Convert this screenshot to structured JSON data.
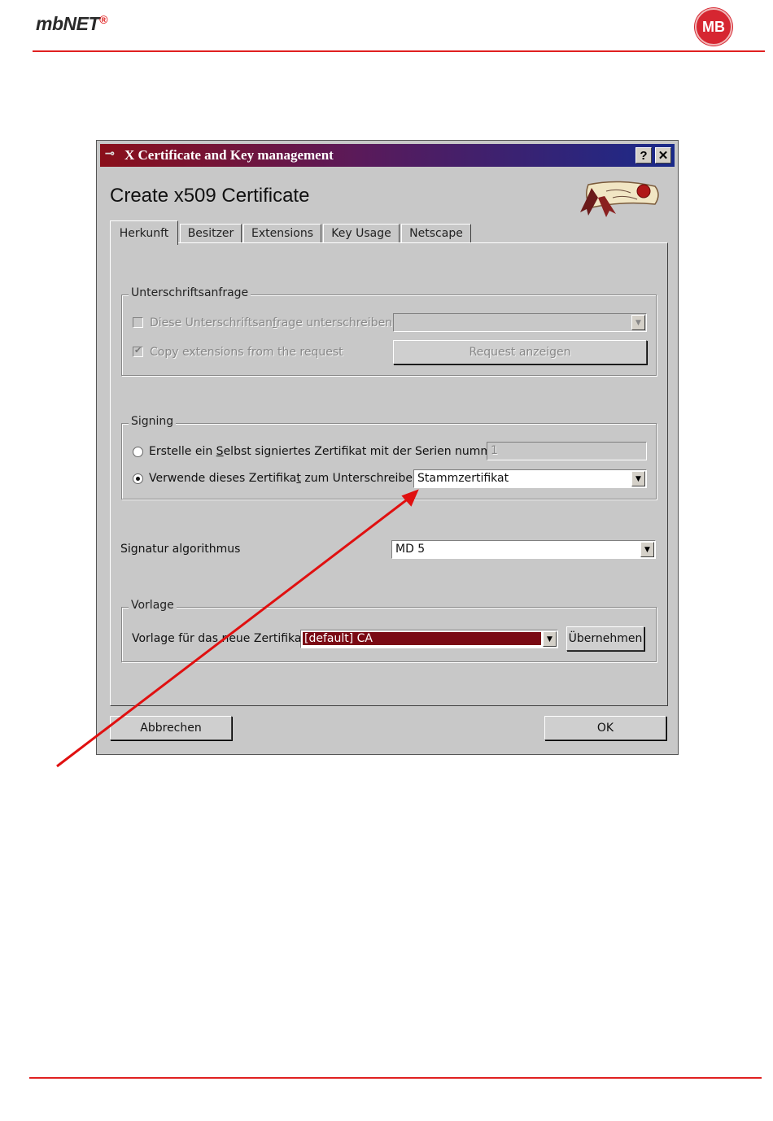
{
  "page": {
    "logo_text": "mbNET",
    "logo_mark": "®",
    "badge_text": "MB",
    "accent_color": "#e02020"
  },
  "dialog": {
    "title": "X Certificate and Key management",
    "help_button": "?",
    "close_button": "✕",
    "heading": "Create x509 Certificate",
    "tabs": [
      {
        "label": "Herkunft",
        "active": true
      },
      {
        "label": "Besitzer",
        "active": false
      },
      {
        "label": "Extensions",
        "active": false
      },
      {
        "label": "Key Usage",
        "active": false
      },
      {
        "label": "Netscape",
        "active": false
      }
    ],
    "request_group": {
      "label": "Unterschriftsanfrage",
      "sign_request": {
        "prefix": "Diese Unterschriftsan",
        "hotkey": "f",
        "suffix": "rage unterschreiben",
        "checked": false,
        "enabled": false
      },
      "request_select_value": "",
      "copy_extensions": {
        "label": "Copy extensions from the request",
        "checked": true,
        "enabled": false
      },
      "show_request_button": "Request anzeigen"
    },
    "signing_group": {
      "label": "Signing",
      "self_signed": {
        "prefix": "Erstelle ein ",
        "hotkey": "S",
        "suffix": "elbst signiertes Zertifikat mit der Serien nummer",
        "selected": false
      },
      "serial_value": "1",
      "use_cert": {
        "prefix": "Verwende dieses Zertifika",
        "hotkey": "t",
        "suffix": " zum Unterschreiben",
        "selected": true
      },
      "cert_select_value": "Stammzertifikat"
    },
    "algorithm": {
      "label": "Signatur algorithmus",
      "value": "MD 5"
    },
    "template_group": {
      "label": "Vorlage",
      "template_label": "Vorlage für das neue Zertifikat",
      "template_value": "[default] CA",
      "apply_button": "Übernehmen"
    },
    "cancel_button": "Abbrechen",
    "ok_button": "OK",
    "arrow_color": "#e01010",
    "highlight_color": "#7a0a14"
  }
}
